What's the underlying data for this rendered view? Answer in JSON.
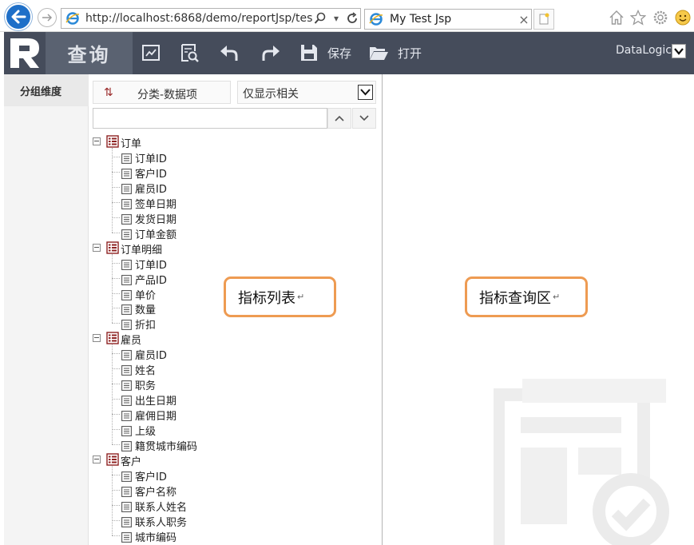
{
  "browser": {
    "url": "http://localhost:6868/demo/reportJsp/test.jsp",
    "tab_title": "My Test Jsp",
    "tab_close": "×"
  },
  "toolbar": {
    "query_label": "查询",
    "save_label": "保存",
    "open_label": "打开",
    "user_label": "DataLogic"
  },
  "rail": {
    "item_label": "分组维度"
  },
  "panel": {
    "sort_label": "分类-数据项",
    "filter_label": "仅显示相关",
    "search_value": ""
  },
  "tree": [
    {
      "label": "订单",
      "fields": [
        "订单ID",
        "客户ID",
        "雇员ID",
        "签单日期",
        "发货日期",
        "订单金额"
      ]
    },
    {
      "label": "订单明细",
      "fields": [
        "订单ID",
        "产品ID",
        "单价",
        "数量",
        "折扣"
      ]
    },
    {
      "label": "雇员",
      "fields": [
        "雇员ID",
        "姓名",
        "职务",
        "出生日期",
        "雇佣日期",
        "上级",
        "籍贯城市编码"
      ]
    },
    {
      "label": "客户",
      "fields": [
        "客户ID",
        "客户名称",
        "联系人姓名",
        "联系人职务",
        "城市编码"
      ]
    }
  ],
  "callouts": {
    "list": "指标列表",
    "query_area": "指标查询区",
    "return_mark": "↵"
  },
  "colors": {
    "toolbar_bg": "#454c5b",
    "callout_border": "#ee9b52",
    "browser_blue": "#1e6fc8"
  }
}
